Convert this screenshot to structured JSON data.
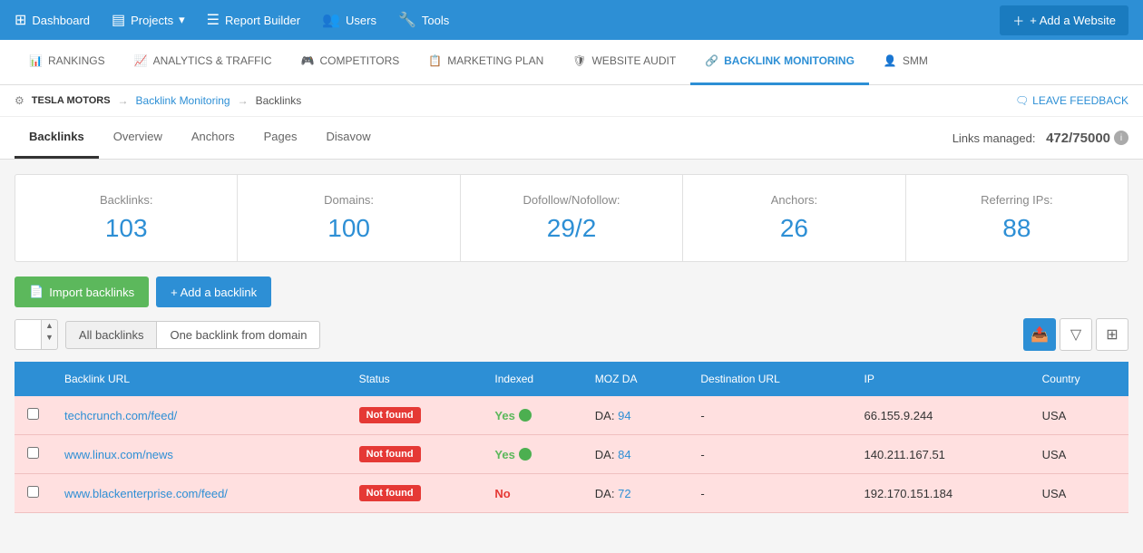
{
  "topNav": {
    "items": [
      {
        "id": "dashboard",
        "label": "Dashboard",
        "icon": "⊞"
      },
      {
        "id": "projects",
        "label": "Projects",
        "icon": "▤",
        "hasArrow": true
      },
      {
        "id": "report-builder",
        "label": "Report Builder",
        "icon": "☰"
      },
      {
        "id": "users",
        "label": "Users",
        "icon": "👥"
      },
      {
        "id": "tools",
        "label": "Tools",
        "icon": "🔧"
      }
    ],
    "addWebsite": "+ Add a Website"
  },
  "secNav": {
    "items": [
      {
        "id": "rankings",
        "label": "Rankings",
        "icon": "📊",
        "active": false
      },
      {
        "id": "analytics-traffic",
        "label": "Analytics & Traffic",
        "icon": "📈",
        "active": false
      },
      {
        "id": "competitors",
        "label": "Competitors",
        "icon": "🎮",
        "active": false
      },
      {
        "id": "marketing-plan",
        "label": "Marketing Plan",
        "icon": "📋",
        "active": false
      },
      {
        "id": "website-audit",
        "label": "Website Audit",
        "icon": "🛡",
        "active": false
      },
      {
        "id": "backlink-monitoring",
        "label": "Backlink Monitoring",
        "icon": "🔗",
        "active": true
      },
      {
        "id": "smm",
        "label": "SMM",
        "icon": "👤",
        "active": false
      }
    ]
  },
  "breadcrumb": {
    "company": "Tesla Motors",
    "section": "Backlink Monitoring",
    "page": "Backlinks",
    "feedbackLabel": "Leave Feedback"
  },
  "tabs": {
    "items": [
      {
        "id": "backlinks",
        "label": "Backlinks",
        "active": true
      },
      {
        "id": "overview",
        "label": "Overview",
        "active": false
      },
      {
        "id": "anchors",
        "label": "Anchors",
        "active": false
      },
      {
        "id": "pages",
        "label": "Pages",
        "active": false
      },
      {
        "id": "disavow",
        "label": "Disavow",
        "active": false
      }
    ],
    "linksManaged": "Links managed:",
    "linksManagedValue": "472/75000"
  },
  "stats": [
    {
      "label": "Backlinks:",
      "value": "103"
    },
    {
      "label": "Domains:",
      "value": "100"
    },
    {
      "label": "Dofollow/Nofollow:",
      "value": "29/2"
    },
    {
      "label": "Anchors:",
      "value": "26"
    },
    {
      "label": "Referring IPs:",
      "value": "88"
    }
  ],
  "actions": {
    "importLabel": "Import backlinks",
    "addLabel": "+ Add a backlink"
  },
  "filters": {
    "allBacklinks": "All backlinks",
    "oneBacklink": "One backlink from domain"
  },
  "tableHeaders": [
    {
      "id": "backlink-url",
      "label": "Backlink URL"
    },
    {
      "id": "status",
      "label": "Status"
    },
    {
      "id": "indexed",
      "label": "Indexed"
    },
    {
      "id": "moz-da",
      "label": "MOZ DA"
    },
    {
      "id": "destination-url",
      "label": "Destination URL"
    },
    {
      "id": "ip",
      "label": "IP"
    },
    {
      "id": "country",
      "label": "Country"
    }
  ],
  "tableRows": [
    {
      "url": "techcrunch.com/feed/",
      "status": "Not found",
      "indexed": "Yes",
      "indexedColor": "yes",
      "mozDA": "94",
      "destinationURL": "-",
      "ip": "66.155.9.244",
      "country": "USA"
    },
    {
      "url": "www.linux.com/news",
      "status": "Not found",
      "indexed": "Yes",
      "indexedColor": "yes",
      "mozDA": "84",
      "destinationURL": "-",
      "ip": "140.211.167.51",
      "country": "USA"
    },
    {
      "url": "www.blackenterprise.com/feed/",
      "status": "Not found",
      "indexed": "No",
      "indexedColor": "no",
      "mozDA": "72",
      "destinationURL": "-",
      "ip": "192.170.151.184",
      "country": "USA"
    }
  ]
}
